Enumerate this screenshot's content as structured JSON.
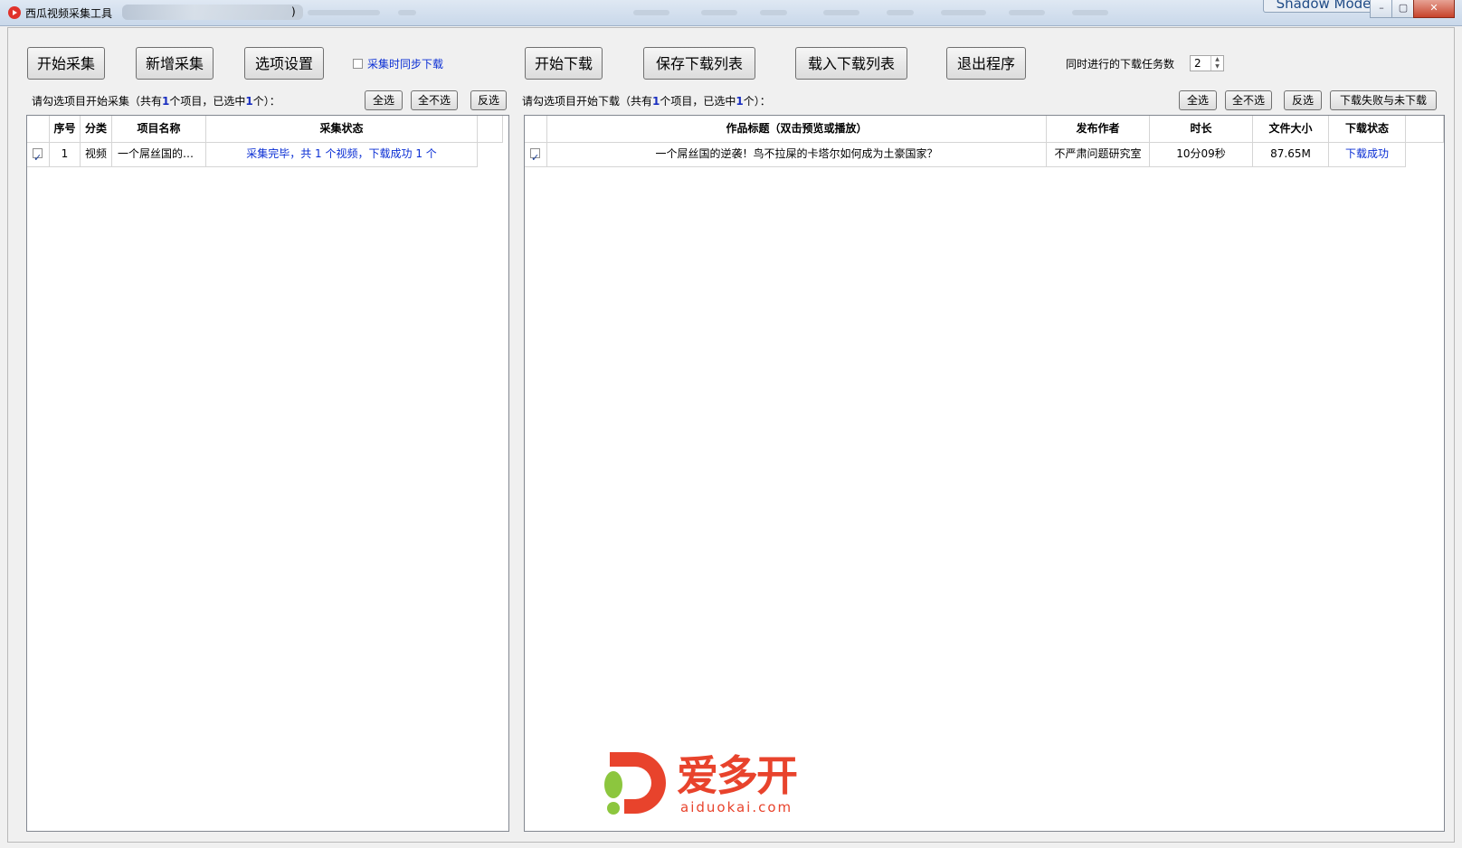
{
  "window": {
    "title": "西瓜视频采集工具",
    "title_suffix": ")",
    "shadow_mode": "Shadow Mode"
  },
  "toolbar": {
    "start_collect": "开始采集",
    "new_collect": "新增采集",
    "options": "选项设置",
    "sync_download_label": "采集时同步下载",
    "sync_download_checked": false,
    "start_download": "开始下载",
    "save_list": "保存下载列表",
    "load_list": "载入下载列表",
    "exit": "退出程序",
    "concurrent_label": "同时进行的下载任务数",
    "concurrent_value": "2"
  },
  "collect_panel": {
    "hint_prefix": "请勾选项目开始采集（共有",
    "total": "1",
    "hint_mid": "个项目，已选中",
    "selected": "1",
    "hint_suffix": "个）：",
    "select_all": "全选",
    "select_none": "全不选",
    "invert": "反选",
    "columns": [
      "序号",
      "分类",
      "项目名称",
      "采集状态"
    ],
    "rows": [
      {
        "checked": true,
        "index": "1",
        "category": "视频",
        "name": "一个屌丝国的…",
        "status": "采集完毕，共 1 个视频，下载成功 1 个"
      }
    ]
  },
  "download_panel": {
    "hint_prefix": "请勾选项目开始下载（共有",
    "total": "1",
    "hint_mid": "个项目，已选中",
    "selected": "1",
    "hint_suffix": "个）：",
    "select_all": "全选",
    "select_none": "全不选",
    "invert": "反选",
    "failed_or_pending": "下载失败与未下载",
    "columns": [
      "作品标题（双击预览或播放）",
      "发布作者",
      "时长",
      "文件大小",
      "下载状态"
    ],
    "rows": [
      {
        "checked": true,
        "title": "一个屌丝国的逆袭！鸟不拉屎的卡塔尔如何成为土豪国家？",
        "author": "不严肃问题研究室",
        "duration": "10分09秒",
        "size": "87.65M",
        "status": "下载成功"
      }
    ]
  },
  "watermark": {
    "brand": "爱多开",
    "url": "aiduokai.com"
  },
  "colors": {
    "link_blue": "#0a2ed4",
    "brand_red": "#e8432c",
    "brand_green": "#8cc63e"
  }
}
